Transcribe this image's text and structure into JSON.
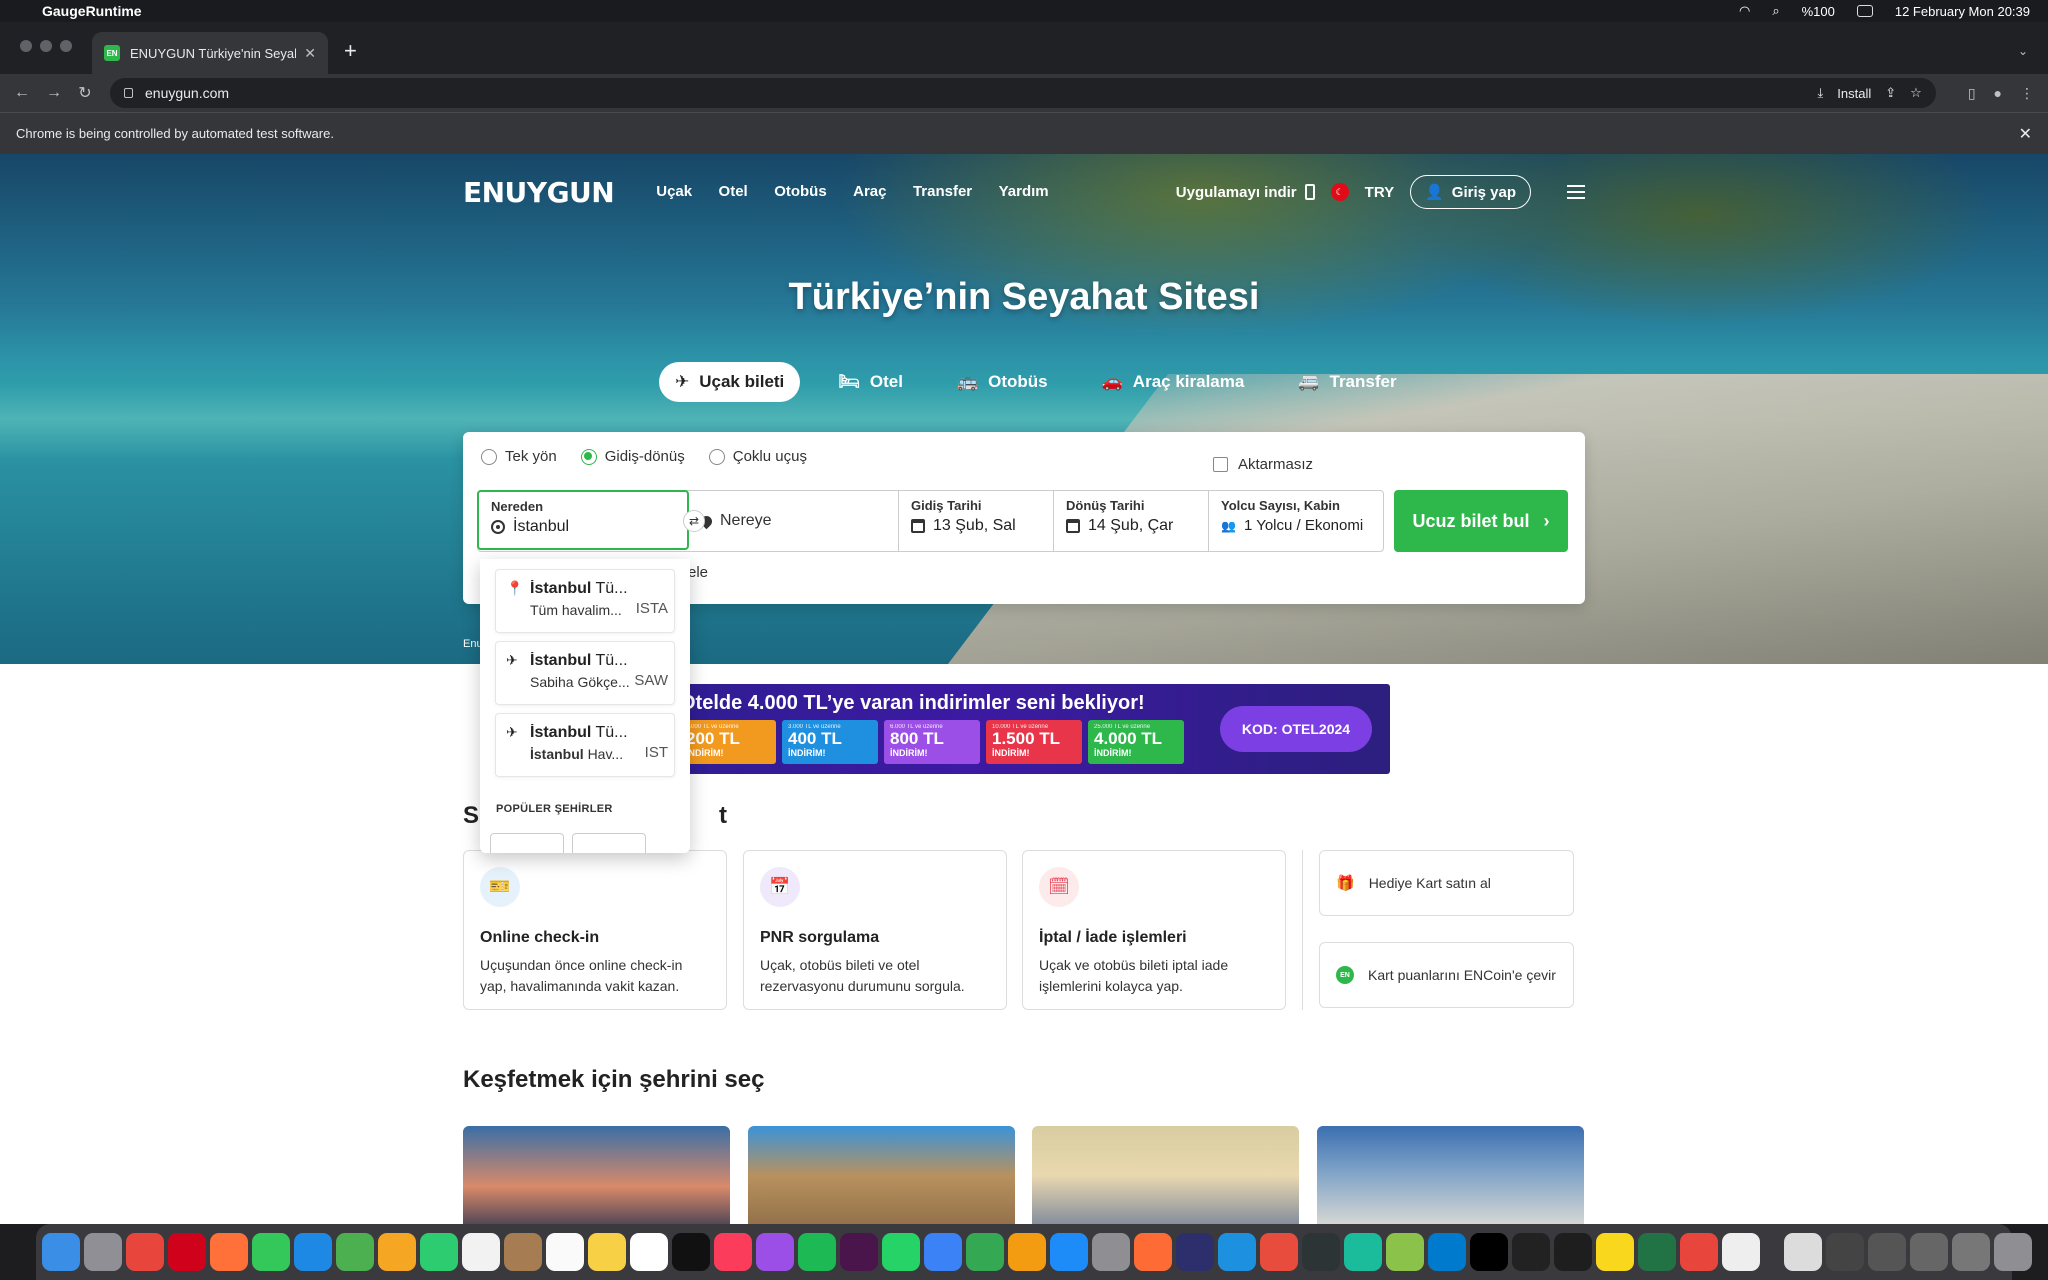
{
  "menubar": {
    "app_name": "GaugeRuntime",
    "battery": "%100",
    "datetime": "12 February Mon  20:39"
  },
  "browser": {
    "tab_title": "ENUYGUN Türkiye'nin Seyahat",
    "favicon_text": "EN",
    "url": "enuygun.com",
    "install_label": "Install",
    "automation_notice": "Chrome is being controlled by automated test software."
  },
  "header": {
    "logo": "ENUYGUN",
    "nav": [
      "Uçak",
      "Otel",
      "Otobüs",
      "Araç",
      "Transfer",
      "Yardım"
    ],
    "download_app": "Uygulamayı indir",
    "currency": "TRY",
    "login": "Giriş yap"
  },
  "hero": {
    "title": "Türkiye’nin Seyahat Sitesi",
    "product_tabs": [
      "Uçak bileti",
      "Otel",
      "Otobüs",
      "Araç kiralama",
      "Transfer"
    ]
  },
  "search": {
    "trip_types": [
      "Tek yön",
      "Gidiş-dönüş",
      "Çoklu uçuş"
    ],
    "selected_trip_type": "Gidiş-dönüş",
    "direct_label": "Aktarmasız",
    "from_label": "Nereden",
    "from_value": "İstanbul",
    "to_placeholder": "Nereye",
    "depart_label": "Gidiş Tarihi",
    "depart_value": "13 Şub, Sal",
    "return_label": "Dönüş Tarihi",
    "return_value": "14 Şub, Çar",
    "pax_label": "Yolcu Sayısı, Kabin",
    "pax_value": "1 Yolcu / Ekonomi",
    "submit": "Ucuz bilet bul",
    "hotel_option_tail": "ele"
  },
  "dropdown": {
    "items": [
      {
        "icon": "pin",
        "city": "İstanbul",
        "country": "Tü...",
        "detail": "Tüm havalim...",
        "code": "ISTA"
      },
      {
        "icon": "plane",
        "city": "İstanbul",
        "country": "Tü...",
        "detail": "Sabiha Gökçe...",
        "code": "SAW"
      },
      {
        "icon": "plane",
        "city": "İstanbul",
        "country": "Tü...",
        "detail_bold": "İstanbul",
        "detail": "Hav...",
        "code": "IST"
      }
    ],
    "section": "POPÜLER ŞEHİRLER"
  },
  "footer_note": "Enu",
  "promo": {
    "headline": "Otelde 4.000 TL’ye varan indirimler seni bekliyor!",
    "coupons": [
      {
        "caption": "2.000 TL ve üzerine",
        "amount": "200 TL",
        "sub": "İNDİRİM!",
        "color": "#f29a1f"
      },
      {
        "caption": "3.000 TL ve üzerine",
        "amount": "400 TL",
        "sub": "İNDİRİM!",
        "color": "#1f8fe0"
      },
      {
        "caption": "6.000 TL ve üzerine",
        "amount": "800 TL",
        "sub": "İNDİRİM!",
        "color": "#9b4fe6"
      },
      {
        "caption": "10.000 TL ve üzerine",
        "amount": "1.500 TL",
        "sub": "İNDİRİM!",
        "color": "#e8354a"
      },
      {
        "caption": "25.000 TL ve üzerine",
        "amount": "4.000 TL",
        "sub": "İNDİRİM!",
        "color": "#2eb84b"
      }
    ],
    "code": "KOD: OTEL2024"
  },
  "services": {
    "title_start": "S",
    "title_end": "t",
    "cards": [
      {
        "title": "Online check-in",
        "desc": "Uçuşundan önce online check-in yap, havalimanında vakit kazan."
      },
      {
        "title": "PNR sorgulama",
        "desc": "Uçak, otobüs bileti ve otel rezervasyonu durumunu sorgula."
      },
      {
        "title": "İptal / İade işlemleri",
        "desc": "Uçak ve otobüs bileti iptal iade işlemlerini kolayca yap."
      }
    ],
    "side": [
      {
        "label": "Hediye Kart satın al"
      },
      {
        "label": "Kart puanlarını ENCoin'e çevir",
        "badge": "EN"
      }
    ]
  },
  "cities": {
    "title": "Keşfetmek için şehrini seç"
  },
  "colors": {
    "brand_green": "#2eb84b",
    "promo_bg": "#3c1aa3"
  }
}
